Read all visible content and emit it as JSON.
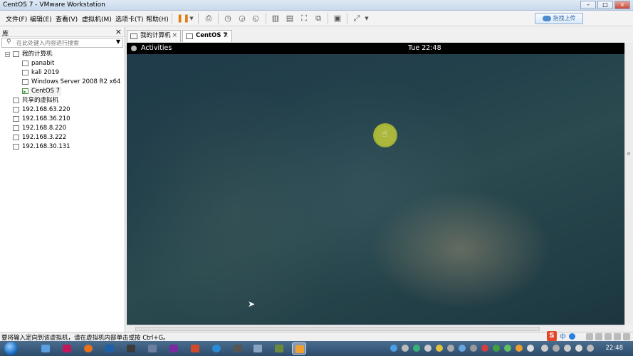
{
  "window": {
    "title": "CentOS 7 - VMware Workstation"
  },
  "menu": [
    {
      "label": "文件(F)"
    },
    {
      "label": "编辑(E)"
    },
    {
      "label": "查看(V)"
    },
    {
      "label": "虚拟机(M)"
    },
    {
      "label": "选项卡(T)"
    },
    {
      "label": "帮助(H)"
    }
  ],
  "toolbar": {
    "upload_label": "拖拽上传"
  },
  "library": {
    "title": "库",
    "search_placeholder": "在此处键入内容进行搜索",
    "my_computer": "我的计算机",
    "vms": [
      {
        "label": "panabit"
      },
      {
        "label": "kali 2019"
      },
      {
        "label": "Windows Server 2008 R2 x64"
      },
      {
        "label": "CentOS 7",
        "running": true
      }
    ],
    "shared_vms": "共享的虚拟机",
    "remote_hosts": [
      {
        "label": "192.168.63.220"
      },
      {
        "label": "192.168.36.210"
      },
      {
        "label": "192.168.8.220"
      },
      {
        "label": "192.168.3.222"
      },
      {
        "label": "192.168.30.131"
      }
    ]
  },
  "tabs": [
    {
      "label": "我的计算机",
      "active": false
    },
    {
      "label": "CentOS 7",
      "active": true
    }
  ],
  "vm_screen": {
    "activities": "Activities",
    "clock": "Tue 22:48"
  },
  "status": {
    "message": "要将输入定向到该虚拟机，请在虚拟机内部单击或按 Ctrl+G。"
  },
  "ime": {
    "lang_label": "中"
  },
  "taskbar": {
    "clock": "22:48"
  }
}
